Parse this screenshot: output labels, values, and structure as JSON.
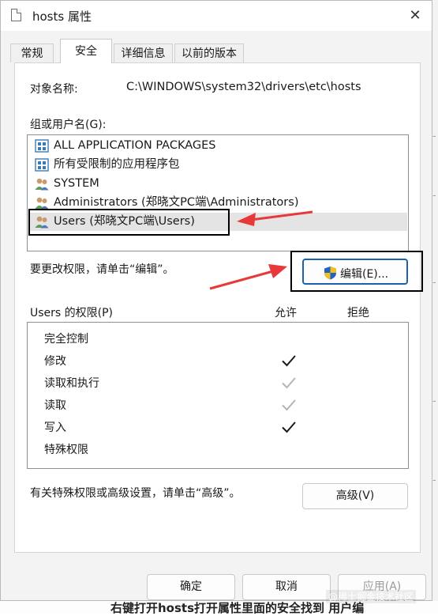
{
  "dialog": {
    "title": "hosts 属性",
    "close_glyph": "✕"
  },
  "tabs": [
    {
      "label": "常规",
      "active": false
    },
    {
      "label": "安全",
      "active": true
    },
    {
      "label": "详细信息",
      "active": false
    },
    {
      "label": "以前的版本",
      "active": false
    }
  ],
  "security": {
    "object_name_label": "对象名称:",
    "object_name_value": "C:\\WINDOWS\\system32\\drivers\\etc\\hosts",
    "group_label": "组或用户名(G):",
    "groups": [
      {
        "name": "ALL APPLICATION PACKAGES",
        "icon": "app-package-icon"
      },
      {
        "name": "所有受限制的应用程序包",
        "icon": "app-package-icon"
      },
      {
        "name": "SYSTEM",
        "icon": "users-group-icon"
      },
      {
        "name": "Administrators (郑晓文PC端\\Administrators)",
        "icon": "users-group-icon"
      },
      {
        "name": "Users (郑晓文PC端\\Users)",
        "icon": "users-group-icon",
        "selected": true
      }
    ],
    "change_hint": "要更改权限，请单击“编辑”。",
    "edit_button": "编辑(E)...",
    "perm_header": "Users 的权限(P)",
    "allow_header": "允许",
    "deny_header": "拒绝",
    "permissions": [
      {
        "name": "完全控制",
        "allow": "none"
      },
      {
        "name": "修改",
        "allow": "checked"
      },
      {
        "name": "读取和执行",
        "allow": "inherited"
      },
      {
        "name": "读取",
        "allow": "inherited"
      },
      {
        "name": "写入",
        "allow": "checked"
      },
      {
        "name": "特殊权限",
        "allow": "none"
      }
    ],
    "advanced_hint": "有关特殊权限或高级设置，请单击“高级”。",
    "advanced_button": "高级(V)"
  },
  "footer": {
    "ok_button": "确定",
    "cancel_button": "取消",
    "apply_button": "应用(A)"
  },
  "background": {
    "bottom_text": "右键打开hosts打开属性里面的安全找到 用户编",
    "watermark": "@稀土掘金技术社区"
  },
  "colors": {
    "annotation_arrow": "#e8393a",
    "shield_blue": "#1e63c6",
    "shield_yellow": "#f2c21b",
    "check_dark": "#1a1a1a",
    "check_inherited": "#b5b5b5"
  }
}
